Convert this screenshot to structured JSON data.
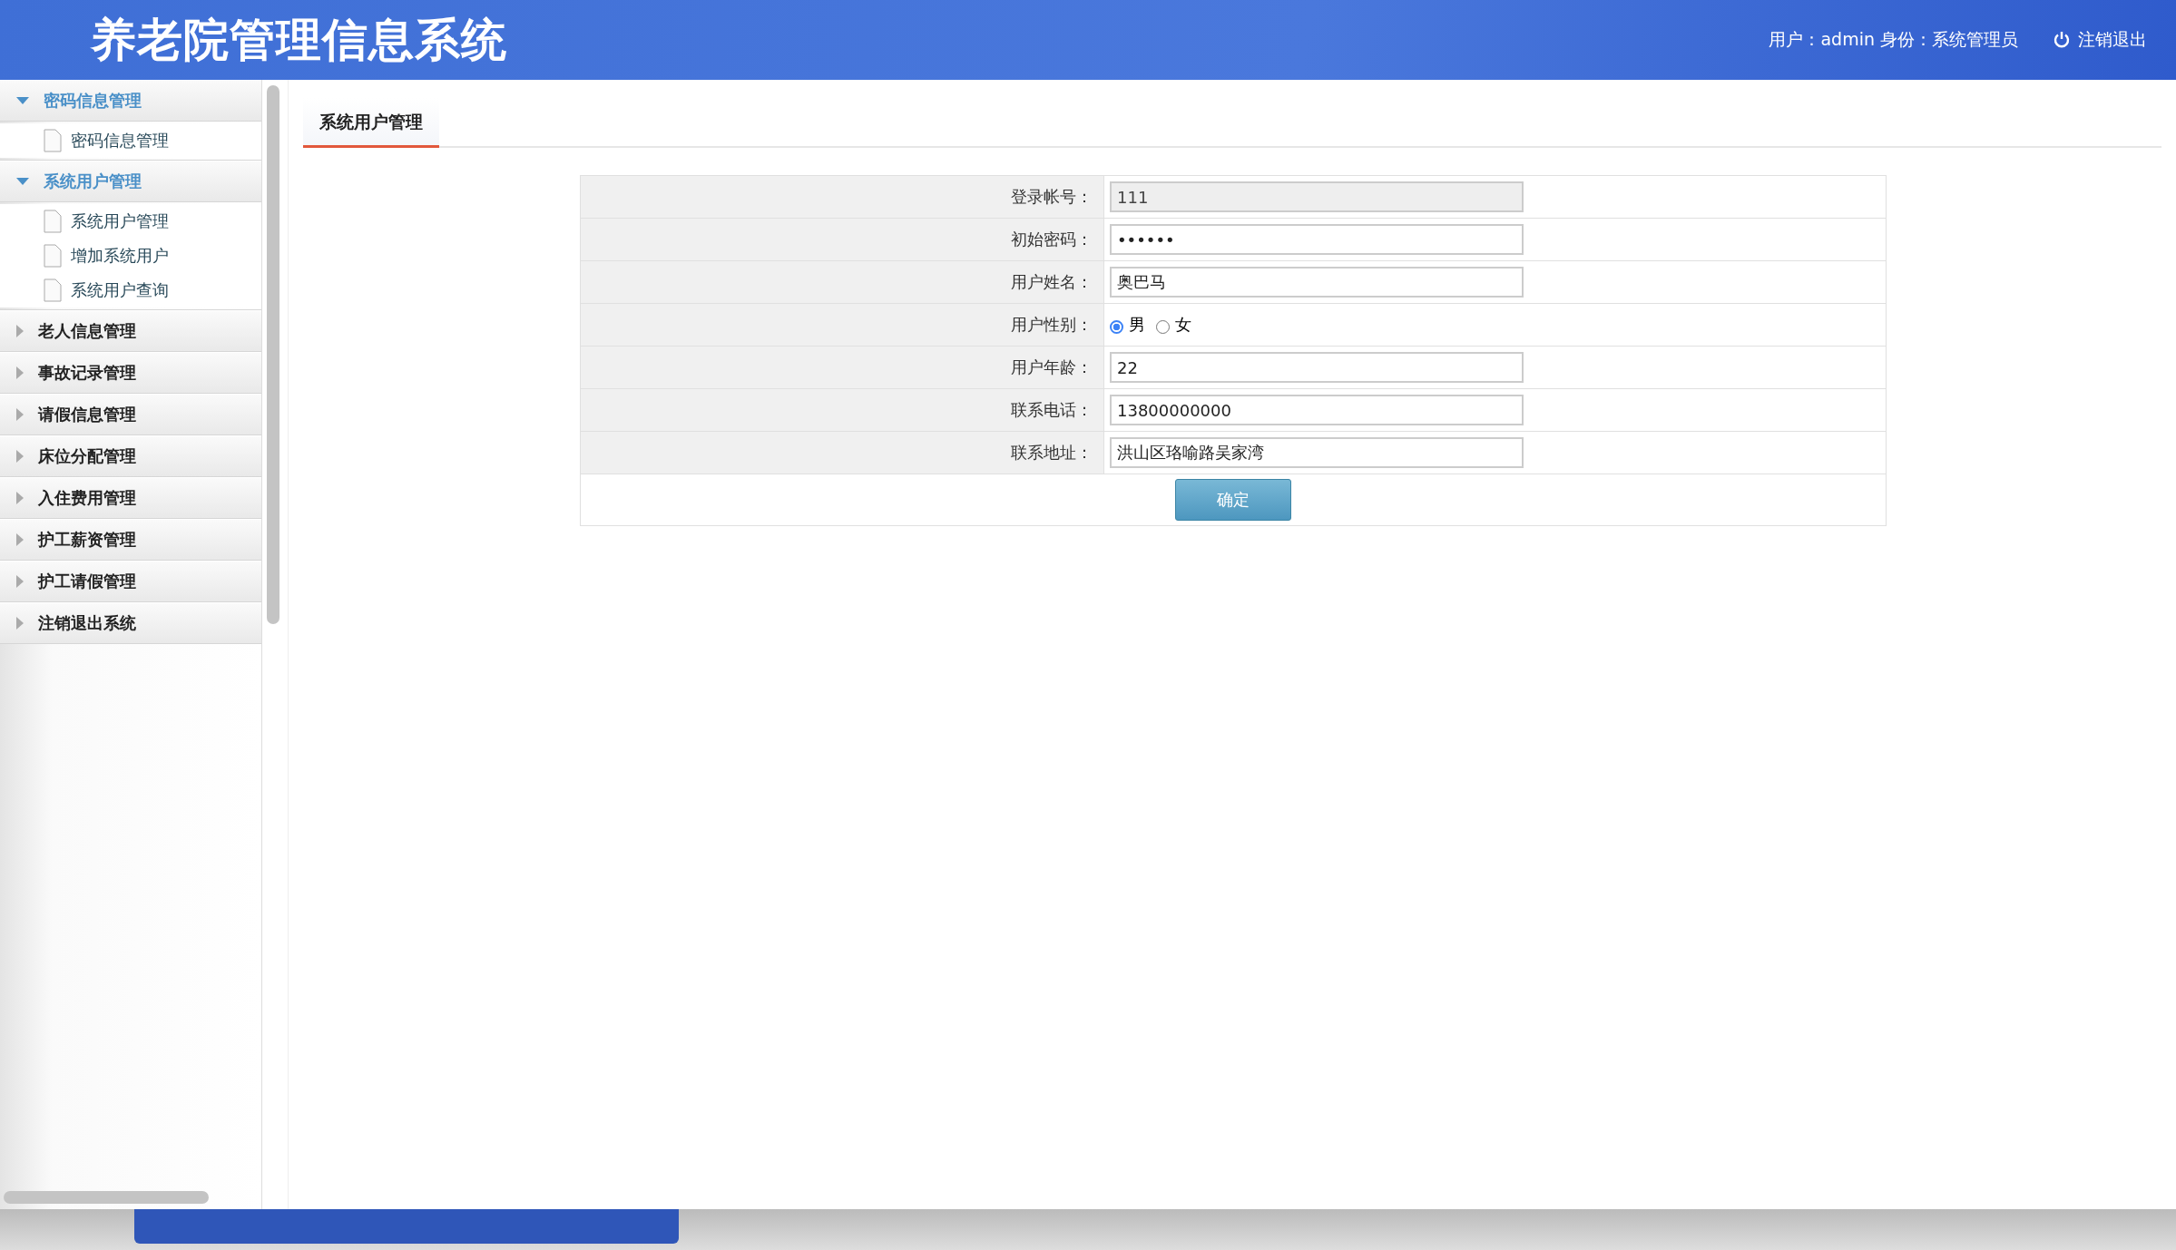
{
  "header": {
    "title": "养老院管理信息系统",
    "user_info": "用户：admin 身份：系统管理员",
    "logout": "注销退出"
  },
  "sidebar": {
    "groups": [
      {
        "label": "密码信息管理",
        "expanded": true,
        "items": [
          "密码信息管理"
        ]
      },
      {
        "label": "系统用户管理",
        "expanded": true,
        "items": [
          "系统用户管理",
          "增加系统用户",
          "系统用户查询"
        ]
      },
      {
        "label": "老人信息管理",
        "expanded": false
      },
      {
        "label": "事故记录管理",
        "expanded": false
      },
      {
        "label": "请假信息管理",
        "expanded": false
      },
      {
        "label": "床位分配管理",
        "expanded": false
      },
      {
        "label": "入住费用管理",
        "expanded": false
      },
      {
        "label": "护工薪资管理",
        "expanded": false
      },
      {
        "label": "护工请假管理",
        "expanded": false
      },
      {
        "label": "注销退出系统",
        "expanded": false
      }
    ]
  },
  "tabs": [
    {
      "label": "系统用户管理",
      "selected": true
    }
  ],
  "form": {
    "rows": [
      {
        "kind": "text",
        "label": "登录帐号：",
        "value": "111",
        "disabled": true
      },
      {
        "kind": "password",
        "label": "初始密码：",
        "value": "••••••",
        "disabled": false
      },
      {
        "kind": "text",
        "label": "用户姓名：",
        "value": "奥巴马",
        "disabled": false
      },
      {
        "kind": "radio",
        "label": "用户性别：",
        "options": [
          {
            "label": "男",
            "selected": true
          },
          {
            "label": "女",
            "selected": false
          }
        ]
      },
      {
        "kind": "text",
        "label": "用户年龄：",
        "value": "22",
        "disabled": false
      },
      {
        "kind": "text",
        "label": "联系电话：",
        "value": "13800000000",
        "disabled": false
      },
      {
        "kind": "text",
        "label": "联系地址：",
        "value": "洪山区珞喻路吴家湾",
        "disabled": false
      }
    ],
    "submit": "确定"
  }
}
